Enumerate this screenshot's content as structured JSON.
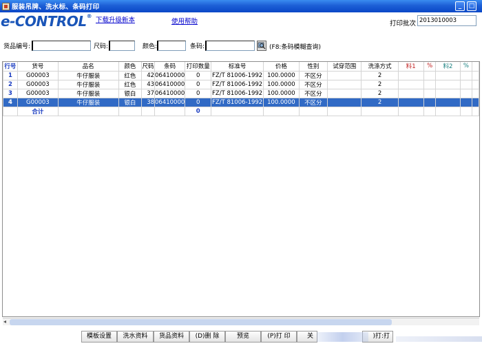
{
  "window": {
    "title": "服装吊牌、洗水标、条码打印",
    "min_glyph": "_",
    "max_glyph": "□"
  },
  "logo": {
    "text": "e-CONTROL",
    "reg": "®"
  },
  "links": {
    "upgrade": "下载升级新本",
    "help": "使用帮助"
  },
  "batch": {
    "label": "打印批次",
    "value": "2013010003"
  },
  "filters": {
    "item_no_label": "货品编号:",
    "size_label": "尺码:",
    "color_label": "颜色:",
    "barcode_label": "条码:",
    "hint": "(F8:条码模糊查询)"
  },
  "table": {
    "columns": [
      "行号",
      "货号",
      "品名",
      "颜色",
      "尺码",
      "条码",
      "打印数量",
      "标准号",
      "价格",
      "性别",
      "试穿范围",
      "洗涤方式",
      "料1",
      "%",
      "料2",
      "%",
      ""
    ],
    "rows": [
      [
        "1",
        "G00003",
        "牛仔服装",
        "红色",
        "42",
        "06410000",
        "0",
        "FZ/T 81006-1992",
        "100.0000",
        "不区分",
        "",
        "2",
        "",
        "",
        "",
        "",
        ""
      ],
      [
        "2",
        "G00003",
        "牛仔服装",
        "红色",
        "43",
        "06410000",
        "0",
        "FZ/T 81006-1992",
        "100.0000",
        "不区分",
        "",
        "2",
        "",
        "",
        "",
        "",
        ""
      ],
      [
        "3",
        "G00003",
        "牛仔服装",
        "银白",
        "37",
        "06410000",
        "0",
        "FZ/T 81006-1992",
        "100.0000",
        "不区分",
        "",
        "2",
        "",
        "",
        "",
        "",
        ""
      ],
      [
        "4",
        "G00003",
        "牛仔服装",
        "银白",
        "38",
        "06410000",
        "0",
        "FZ/T 81006-1992",
        "100.0000",
        "不区分",
        "",
        "2",
        "",
        "",
        "",
        "",
        ""
      ]
    ],
    "selected_row": 4,
    "total": {
      "label": "合计",
      "qty": "0"
    }
  },
  "scrollbar": {
    "left_arrow": "◂"
  },
  "buttons": {
    "template": "模板设置",
    "wash": "洗水资料",
    "goods": "货品资料",
    "delete": "(D)删 除",
    "preview": "预览",
    "print": "(P)打 印",
    "close": "关",
    "print2": ")打:打"
  },
  "colors": {
    "selection": "#316ac5",
    "titlebar": "#0a47c7",
    "logo": "#1a55b8",
    "link": "#0000cc"
  }
}
